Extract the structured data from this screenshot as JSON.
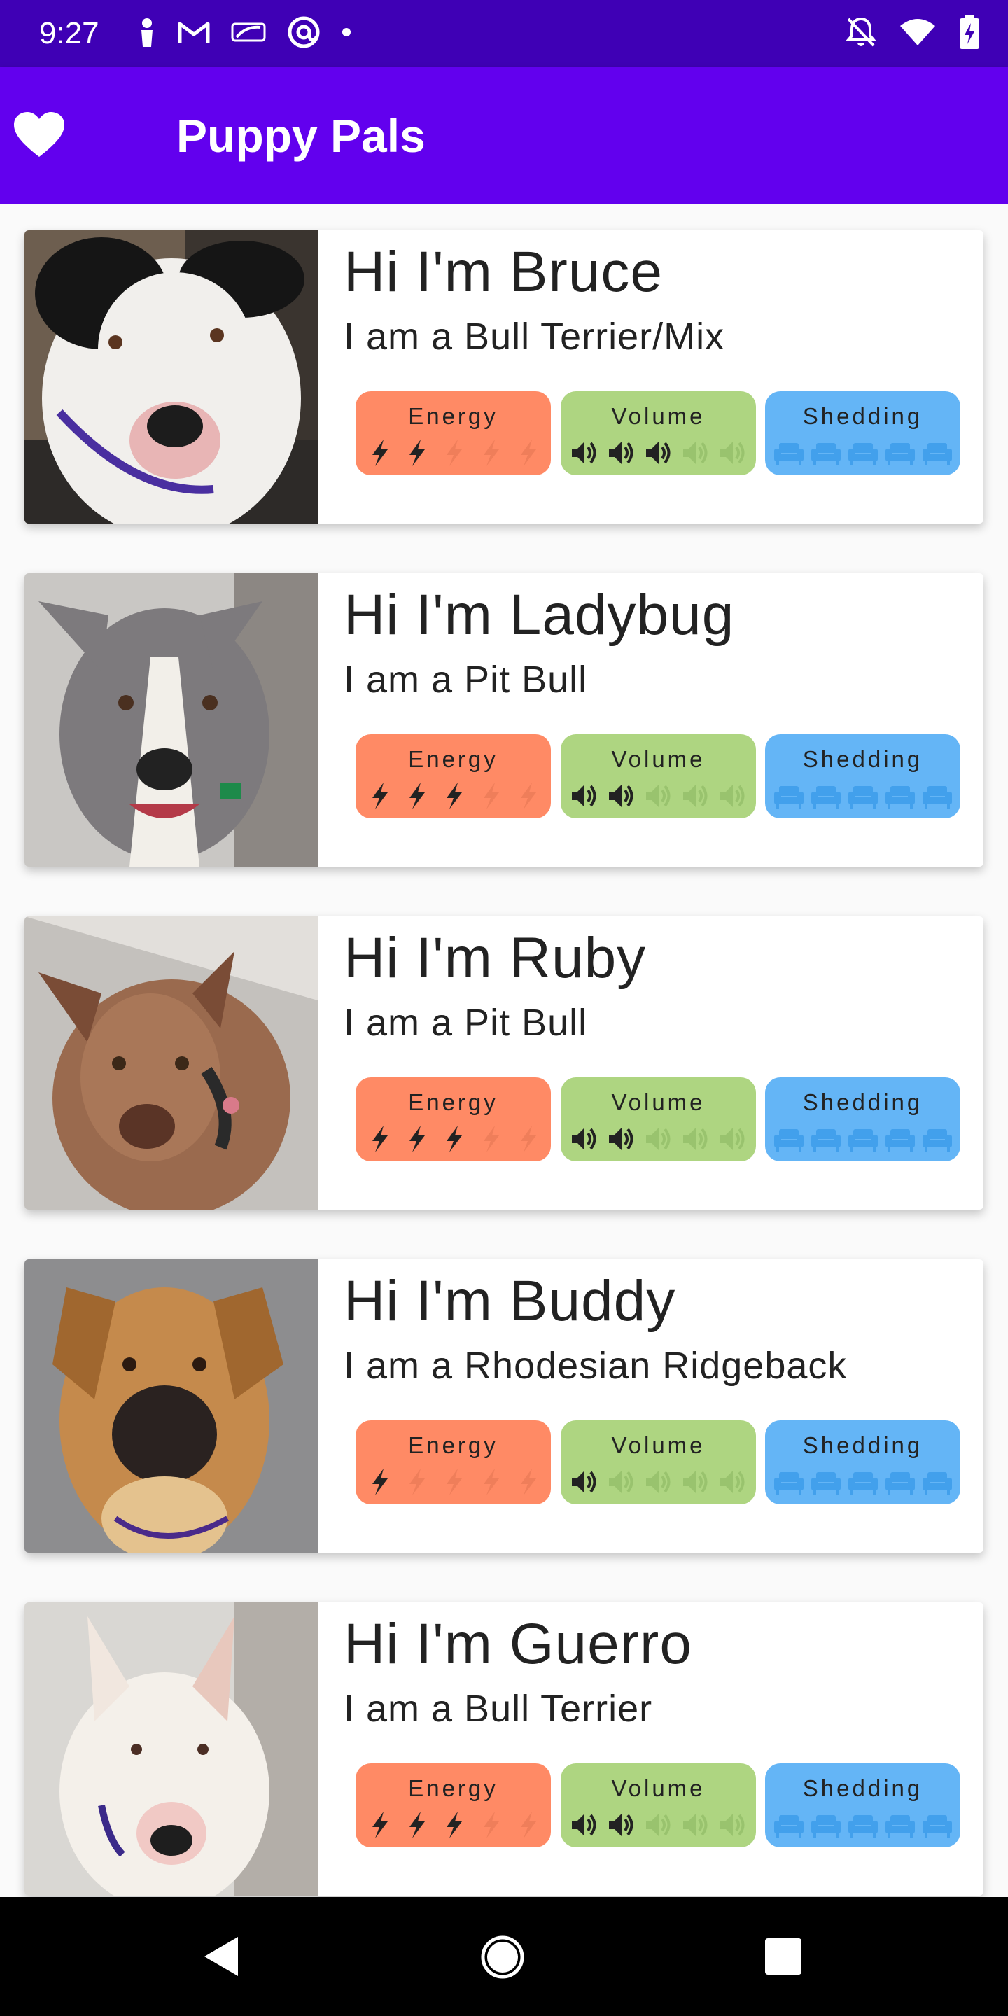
{
  "status_bar": {
    "time": "9:27",
    "left_icons": [
      "person-icon",
      "gmail-icon",
      "mlb-icon",
      "at-sign-icon",
      "dot-icon"
    ],
    "right_icons": [
      "notifications-off-icon",
      "wifi-icon",
      "battery-charging-icon"
    ]
  },
  "app_bar": {
    "title": "Puppy Pals",
    "icon": "heart-icon"
  },
  "rating_labels": {
    "energy": "Energy",
    "volume": "Volume",
    "shedding": "Shedding"
  },
  "colors": {
    "status_bar": "#3f00b5",
    "app_bar": "#6200ee",
    "energy_chip": "#ff8a65",
    "volume_chip": "#aed581",
    "shedding_chip": "#64b5f6"
  },
  "dogs": [
    {
      "name": "Hi I'm Bruce",
      "breed": "I am a Bull Terrier/Mix",
      "energy": 2,
      "volume": 3,
      "shedding": 5
    },
    {
      "name": "Hi I'm Ladybug",
      "breed": "I am a Pit Bull",
      "energy": 3,
      "volume": 2,
      "shedding": 5
    },
    {
      "name": "Hi I'm Ruby",
      "breed": "I am a Pit Bull",
      "energy": 3,
      "volume": 2,
      "shedding": 5
    },
    {
      "name": "Hi I'm Buddy",
      "breed": "I am a Rhodesian Ridgeback",
      "energy": 1,
      "volume": 1,
      "shedding": 5
    },
    {
      "name": "Hi I'm Guerro",
      "breed": "I am a Bull Terrier",
      "energy": 3,
      "volume": 2,
      "shedding": 5
    }
  ],
  "rating_max": 5,
  "nav_bar": {
    "buttons": [
      "back-icon",
      "home-icon",
      "recents-icon"
    ]
  }
}
